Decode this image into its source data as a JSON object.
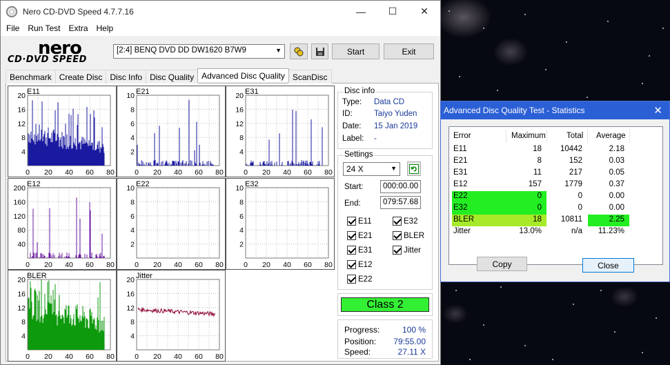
{
  "window": {
    "title": "Nero CD-DVD Speed 4.7.7.16",
    "minimize": "—",
    "maximize": "☐",
    "close": "✕"
  },
  "menu": [
    "File",
    "Run Test",
    "Extra",
    "Help"
  ],
  "toolbar": {
    "logo_top": "nero",
    "logo_bottom": "CD·DVD SPEED",
    "drive": "[2:4]   BENQ DVD DD DW1620 B7W9",
    "start": "Start",
    "exit": "Exit"
  },
  "tabs": [
    "Benchmark",
    "Create Disc",
    "Disc Info",
    "Disc Quality",
    "Advanced Disc Quality",
    "ScanDisc"
  ],
  "active_tab": "Advanced Disc Quality",
  "disc_info": {
    "title": "Disc info",
    "rows": [
      {
        "k": "Type:",
        "v": "Data CD"
      },
      {
        "k": "ID:",
        "v": "Taiyo Yuden"
      },
      {
        "k": "Date:",
        "v": "15 Jan 2019"
      },
      {
        "k": "Label:",
        "v": "-"
      }
    ]
  },
  "settings": {
    "title": "Settings",
    "speed": "24 X",
    "start_label": "Start:",
    "start": "000:00.00",
    "end_label": "End:",
    "end": "079:57.68",
    "checks_left": [
      "E11",
      "E21",
      "E31",
      "E12",
      "E22"
    ],
    "checks_right": [
      "E32",
      "BLER",
      "Jitter"
    ]
  },
  "class_label": "Class 2",
  "progress": {
    "rows": [
      {
        "k": "Progress:",
        "v": "100 %"
      },
      {
        "k": "Position:",
        "v": "79:55.00"
      },
      {
        "k": "Speed:",
        "v": "27.11 X"
      }
    ]
  },
  "graphs": [
    {
      "name": "E11",
      "yticks": [
        "20",
        "16",
        "12",
        "8",
        "4"
      ],
      "xticks": [
        "0",
        "20",
        "40",
        "60",
        "80"
      ],
      "color": "#1a1aa0",
      "ymax": 20
    },
    {
      "name": "E21",
      "yticks": [
        "10",
        "8",
        "6",
        "4",
        "2"
      ],
      "xticks": [
        "0",
        "20",
        "40",
        "60",
        "80"
      ],
      "color": "#1a1aa0",
      "ymax": 10
    },
    {
      "name": "E31",
      "yticks": [
        "20",
        "16",
        "12",
        "8",
        "4"
      ],
      "xticks": [
        "0",
        "20",
        "40",
        "60",
        "80"
      ],
      "color": "#1a1aa0",
      "ymax": 20
    },
    {
      "name": "E12",
      "yticks": [
        "200",
        "160",
        "120",
        "80",
        "40"
      ],
      "xticks": [
        "0",
        "20",
        "40",
        "60",
        "80"
      ],
      "color": "#6a1aa0",
      "ymax": 200
    },
    {
      "name": "E22",
      "yticks": [
        "10",
        "8",
        "6",
        "4",
        "2"
      ],
      "xticks": [
        "0",
        "20",
        "40",
        "60",
        "80"
      ],
      "color": "#1a1aa0",
      "ymax": 10
    },
    {
      "name": "E32",
      "yticks": [
        "10",
        "8",
        "6",
        "4",
        "2"
      ],
      "xticks": [
        "0",
        "20",
        "40",
        "60",
        "80"
      ],
      "color": "#1a1aa0",
      "ymax": 10
    },
    {
      "name": "BLER",
      "yticks": [
        "20",
        "16",
        "12",
        "8",
        "4"
      ],
      "xticks": [
        "0",
        "20",
        "40",
        "60",
        "80"
      ],
      "color": "#0d9a0d",
      "ymax": 20
    },
    {
      "name": "Jitter",
      "yticks": [
        "20",
        "16",
        "12",
        "8",
        "4"
      ],
      "xticks": [
        "0",
        "20",
        "40",
        "60",
        "80"
      ],
      "color": "#8a0030",
      "ymax": 20
    }
  ],
  "stats_dialog": {
    "title": "Advanced Disc Quality Test - Statistics",
    "close": "✕",
    "headers": [
      "Error",
      "Maximum",
      "Total",
      "Average"
    ],
    "rows": [
      {
        "error": "E11",
        "max": "18",
        "total": "10442",
        "avg": "2.18",
        "hl": ""
      },
      {
        "error": "E21",
        "max": "8",
        "total": "152",
        "avg": "0.03",
        "hl": ""
      },
      {
        "error": "E31",
        "max": "11",
        "total": "217",
        "avg": "0.05",
        "hl": ""
      },
      {
        "error": "E12",
        "max": "157",
        "total": "1779",
        "avg": "0.37",
        "hl": ""
      },
      {
        "error": "E22",
        "max": "0",
        "total": "0",
        "avg": "0.00",
        "hl": "bright"
      },
      {
        "error": "E32",
        "max": "0",
        "total": "0",
        "avg": "0.00",
        "hl": "bright"
      },
      {
        "error": "BLER",
        "max": "18",
        "total": "10811",
        "avg": "2.25",
        "hl": "lime"
      },
      {
        "error": "Jitter",
        "max": "13.0%",
        "total": "n/a",
        "avg": "11.23%",
        "hl": ""
      }
    ],
    "copy": "Copy",
    "close_btn": "Close",
    "colors": {
      "bright": "#22ee22",
      "lime": "#a6ea2a"
    }
  }
}
